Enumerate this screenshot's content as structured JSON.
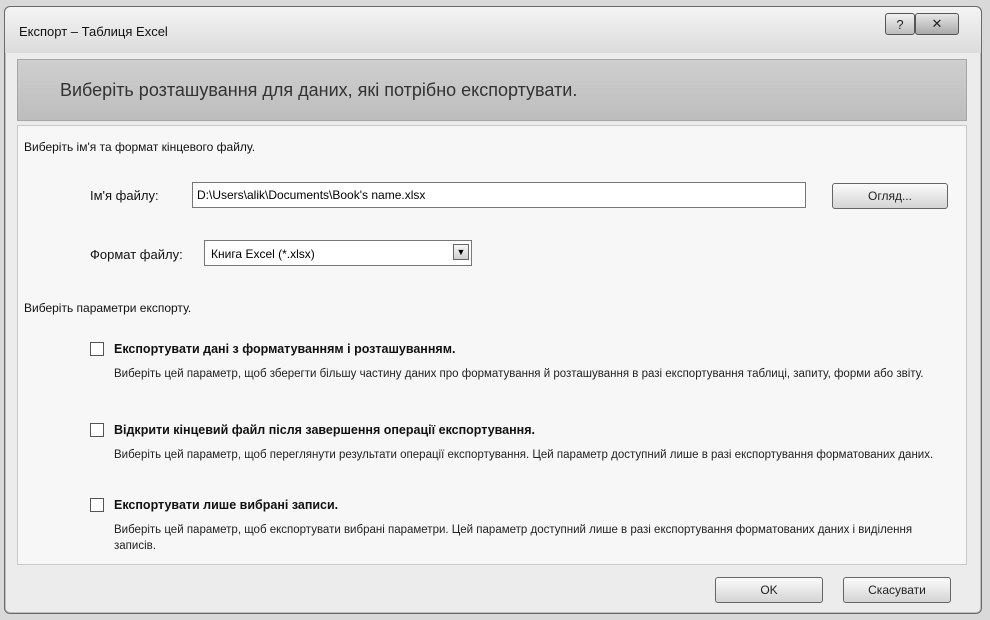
{
  "window": {
    "title": "Експорт – Таблиця Excel",
    "help_label": "?",
    "close_label": "✕"
  },
  "header": {
    "text": "Виберіть розташування для даних, які потрібно експортувати."
  },
  "file_section": {
    "heading": "Виберіть ім'я та формат кінцевого файлу.",
    "filename_label": "Ім'я файлу:",
    "filename_value": "D:\\Users\\alik\\Documents\\Book's name.xlsx",
    "browse_label": "Огляд...",
    "format_label": "Формат файлу:",
    "format_value": "Книга Excel (*.xlsx)"
  },
  "export_options": {
    "heading": "Виберіть параметри експорту.",
    "items": [
      {
        "title": "Експортувати дані з форматуванням і розташуванням.",
        "description": "Виберіть цей параметр, щоб зберегти більшу частину даних про форматування й розташування в разі експортування таблиці, запиту, форми або звіту.",
        "checked": false
      },
      {
        "title": "Відкрити кінцевий файл після завершення операції експортування.",
        "description": "Виберіть цей параметр, щоб переглянути результати операції експортування. Цей параметр доступний лише в разі експортування форматованих даних.",
        "checked": false
      },
      {
        "title": "Експортувати лише вибрані записи.",
        "description": "Виберіть цей параметр, щоб експортувати вибрані параметри. Цей параметр доступний лише в разі експортування форматованих даних і виділення записів.",
        "checked": false
      }
    ]
  },
  "footer": {
    "ok_label": "OK",
    "cancel_label": "Скасувати"
  }
}
